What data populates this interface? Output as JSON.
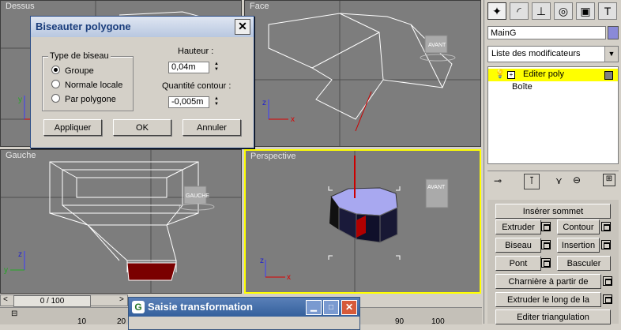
{
  "viewports": {
    "top": "Dessus",
    "front": "Face",
    "left": "Gauche",
    "perspective": "Perspective"
  },
  "viewcube": {
    "front": "AVANT",
    "left": "GAUCHE"
  },
  "axes": {
    "x": "x",
    "y": "y",
    "z": "z"
  },
  "bevel_dialog": {
    "title": "Biseauter polygone",
    "bevel_type_group": "Type de biseau",
    "options": [
      "Groupe",
      "Normale locale",
      "Par polygone"
    ],
    "selected": "Groupe",
    "height_label": "Hauteur :",
    "height_value": "0,04m",
    "outline_label": "Quantité contour :",
    "outline_value": "-0,005m",
    "apply": "Appliquer",
    "ok": "OK",
    "cancel": "Annuler"
  },
  "command_panel": {
    "object_name": "MainG",
    "modifier_list": "Liste des modificateurs",
    "stack": [
      {
        "label": "Editer poly",
        "active": true
      },
      {
        "label": "Boîte",
        "active": false
      }
    ],
    "buttons": {
      "insert_vertex": "Insérer sommet",
      "extrude": "Extruder",
      "outline": "Contour",
      "bevel": "Biseau",
      "inset": "Insertion",
      "bridge": "Pont",
      "flip": "Basculer",
      "hinge": "Charnière à partir de l'arête",
      "extrude_spline": "Extruder le long de la spline",
      "edit_triangulation": "Editer triangulation"
    }
  },
  "timeline": {
    "frame": "0 / 100",
    "ticks": [
      "10",
      "20",
      "90",
      "100"
    ]
  },
  "transform_dialog": {
    "title": "Saisie transformation"
  },
  "colors": {
    "viewport_bg": "#7d7d7d",
    "active_border": "#ffff00",
    "highlight": "#ffff00",
    "selected_face": "#7a0000"
  }
}
